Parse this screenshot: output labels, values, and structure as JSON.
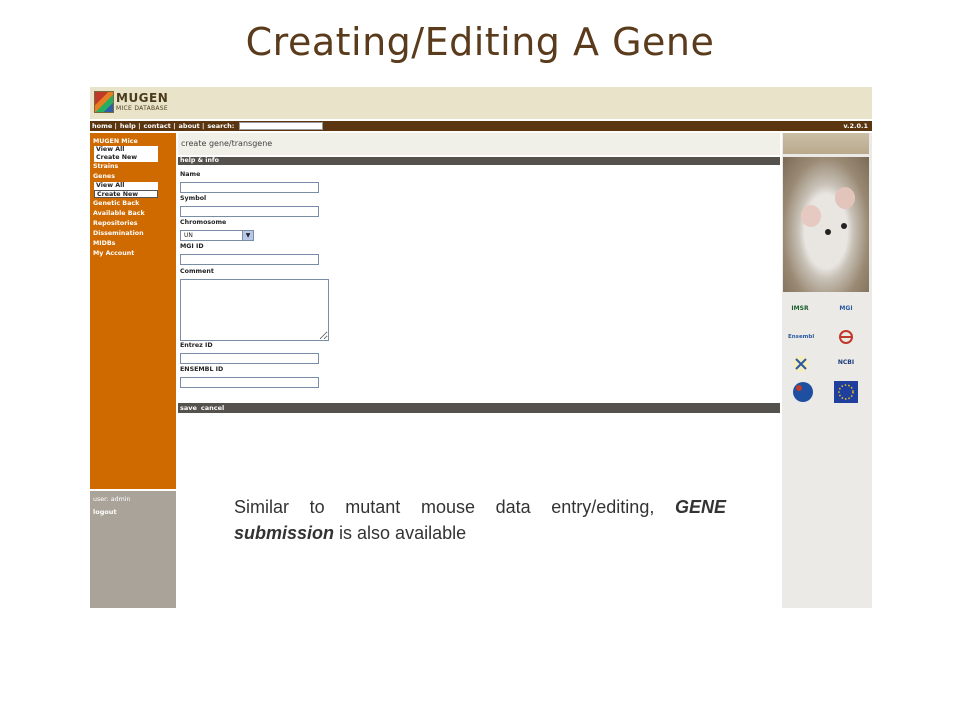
{
  "slide": {
    "title": "Creating/Editing A Gene",
    "caption_part1": "Similar to mutant mouse data entry/editing,",
    "caption_emphasis": "GENE submission",
    "caption_part2": " is also available"
  },
  "header": {
    "logo_text": "MUGEN",
    "logo_subtext": "MICE DATABASE"
  },
  "topnav": {
    "home": "home |",
    "help": "help |",
    "contact": "contact |",
    "about": "about |",
    "search_label": "search:",
    "search_value": "",
    "version": "v.2.0.1"
  },
  "sidebar": {
    "mugen_mice": "MUGEN Mice",
    "mugen_view_all": "View All",
    "mugen_create_new": "Create New",
    "strains": "Strains",
    "genes": "Genes",
    "genes_view_all": "View All",
    "genes_create_new": "Create New",
    "genetic_back": "Genetic Back",
    "available_back": "Available Back",
    "repositories": "Repositories",
    "dissemination": "Dissemination",
    "midbs": "MIDBs",
    "my_account": "My Account",
    "user": "user: admin",
    "logout": "logout"
  },
  "form": {
    "page_title": "create gene/transgene",
    "help_info": "help & info",
    "name_label": "Name",
    "symbol_label": "Symbol",
    "chromosome_label": "Chromosome",
    "chromosome_value": "UN",
    "mgi_label": "MGI ID",
    "comment_label": "Comment",
    "entrez_label": "Entrez ID",
    "ensembl_label": "ENSEMBL ID",
    "save": "save",
    "cancel": "cancel"
  },
  "partner_logos": {
    "imsr": "IMSR",
    "mgi": "MGI",
    "ensembl": "Ensembl",
    "ncbi": "NCBI"
  },
  "colors": {
    "sidebar": "#cf6a00",
    "topbar": "#5b3410",
    "title": "#5a3b1c"
  }
}
